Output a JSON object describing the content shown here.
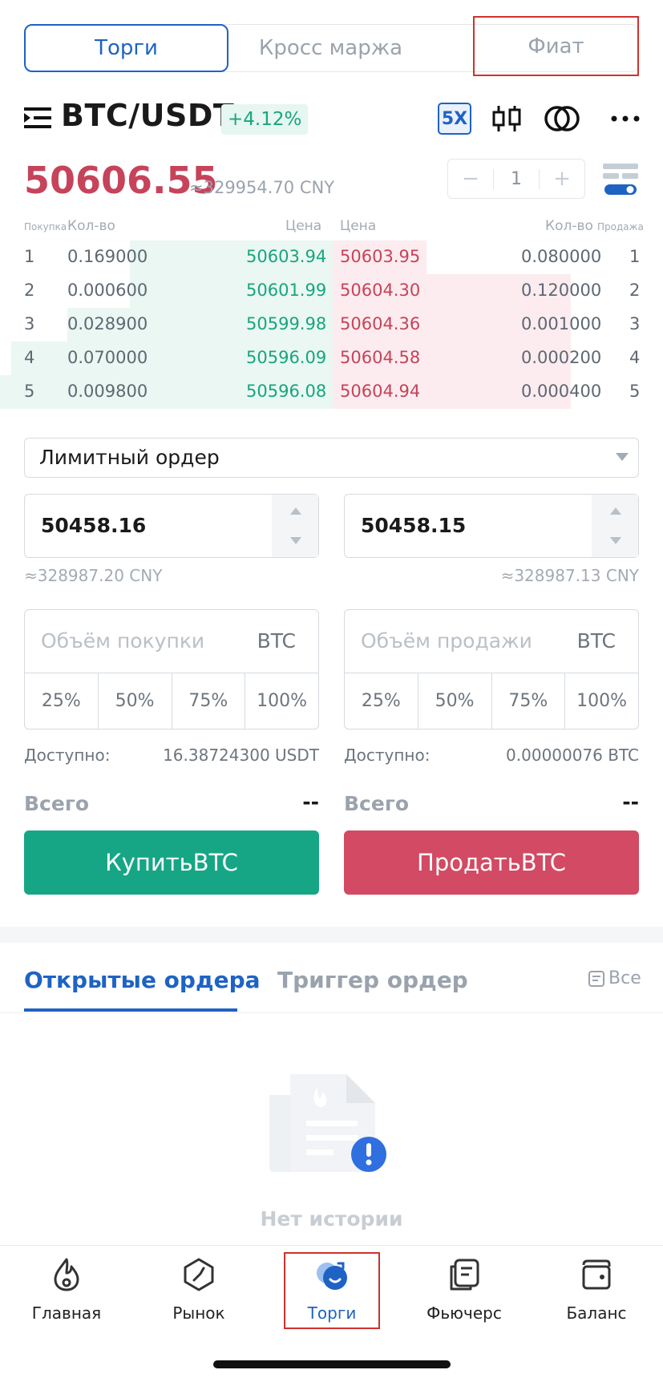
{
  "mode_tabs": [
    {
      "label": "Торги"
    },
    {
      "label": "Кросс маржа"
    },
    {
      "label": "Фиат"
    }
  ],
  "pair": {
    "symbol": "BTC/USDT",
    "change": "+4.12%",
    "leverage": "5X"
  },
  "price": {
    "last": "50606.55",
    "cny": "≈329954.70 CNY"
  },
  "depth_stepper": {
    "minus": "−",
    "value": "1",
    "plus": "+"
  },
  "orderbook": {
    "buy_label": "Покупка",
    "qty_label": "Кол-во",
    "price_label": "Цена",
    "sell_label": "Продажа",
    "rows": [
      {
        "idx": "1",
        "bid_qty": "0.169000",
        "bid": "50603.94",
        "ask": "50603.95",
        "ask_qty": "0.080000"
      },
      {
        "idx": "2",
        "bid_qty": "0.000600",
        "bid": "50601.99",
        "ask": "50604.30",
        "ask_qty": "0.120000"
      },
      {
        "idx": "3",
        "bid_qty": "0.028900",
        "bid": "50599.98",
        "ask": "50604.36",
        "ask_qty": "0.001000"
      },
      {
        "idx": "4",
        "bid_qty": "0.070000",
        "bid": "50596.09",
        "ask": "50604.58",
        "ask_qty": "0.000200"
      },
      {
        "idx": "5",
        "bid_qty": "0.009800",
        "bid": "50596.08",
        "ask": "50604.94",
        "ask_qty": "0.000400"
      }
    ]
  },
  "order_form": {
    "order_type": "Лимитный ордер",
    "buy": {
      "price": "50458.16",
      "price_cny": "≈328987.20 CNY",
      "volume_placeholder": "Объём покупки",
      "unit": "BTC",
      "percents": [
        "25%",
        "50%",
        "75%",
        "100%"
      ],
      "available_label": "Доступно:",
      "available_value": "16.38724300 USDT",
      "total_label": "Всего",
      "total_value": "--",
      "submit": "КупитьBTC"
    },
    "sell": {
      "price": "50458.15",
      "price_cny": "≈328987.13 CNY",
      "volume_placeholder": "Объём продажи",
      "unit": "BTC",
      "percents": [
        "25%",
        "50%",
        "75%",
        "100%"
      ],
      "available_label": "Доступно:",
      "available_value": "0.00000076 BTC",
      "total_label": "Всего",
      "total_value": "--",
      "submit": "ПродатьBTC"
    }
  },
  "orders": {
    "tab_open": "Открытые ордера",
    "tab_trigger": "Триггер ордер",
    "all": "Все",
    "empty": "Нет истории"
  },
  "bottom_nav": [
    {
      "label": "Главная",
      "icon": "flame-icon"
    },
    {
      "label": "Рынок",
      "icon": "market-icon"
    },
    {
      "label": "Торги",
      "icon": "trade-icon"
    },
    {
      "label": "Фьючерс",
      "icon": "futures-icon"
    },
    {
      "label": "Баланс",
      "icon": "wallet-icon"
    }
  ],
  "colors": {
    "accent": "#1e63c4",
    "buy": "#17a685",
    "sell": "#d24a63",
    "highlight": "#d0312d"
  }
}
